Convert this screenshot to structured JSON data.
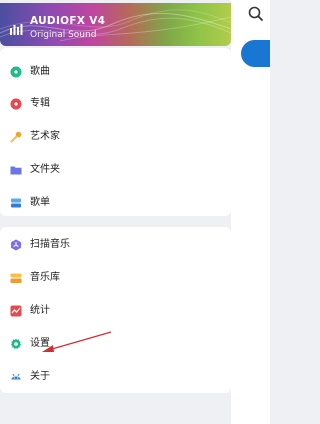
{
  "header": {
    "title": "AUDIOFX V4",
    "subtitle": "Original Sound"
  },
  "menu_primary": [
    {
      "label": "歌曲",
      "icon": "song-disc-icon"
    },
    {
      "label": "专辑",
      "icon": "album-disc-icon"
    },
    {
      "label": "艺术家",
      "icon": "microphone-icon"
    },
    {
      "label": "文件夹",
      "icon": "folder-icon"
    },
    {
      "label": "歌单",
      "icon": "playlist-icon"
    }
  ],
  "menu_secondary": [
    {
      "label": "扫描音乐",
      "icon": "scan-icon"
    },
    {
      "label": "音乐库",
      "icon": "library-icon"
    },
    {
      "label": "统计",
      "icon": "stats-icon"
    },
    {
      "label": "设置",
      "icon": "gear-icon"
    },
    {
      "label": "关于",
      "icon": "android-icon"
    }
  ],
  "colors": {
    "accent": "#1976d2",
    "annotation_arrow": "#d32f2f"
  }
}
